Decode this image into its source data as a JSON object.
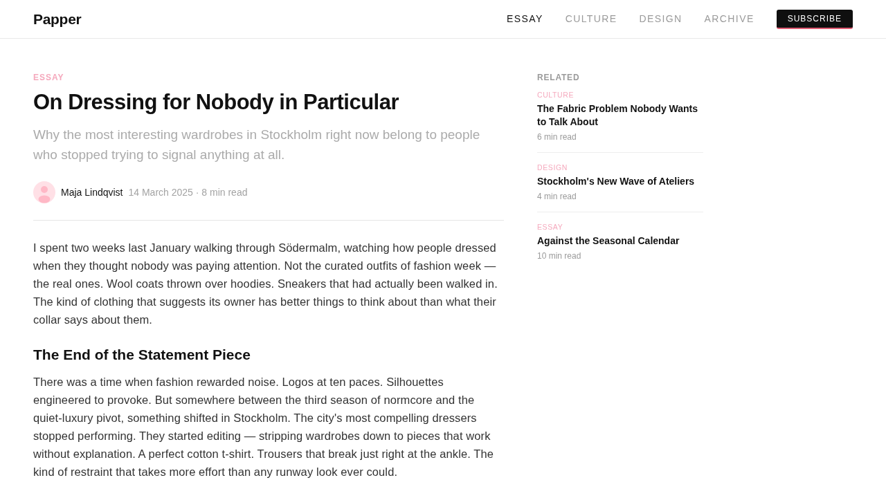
{
  "header": {
    "logo": "Papper",
    "nav": [
      {
        "label": "ESSAY",
        "selected": true
      },
      {
        "label": "CULTURE",
        "selected": false
      },
      {
        "label": "DESIGN",
        "selected": false
      },
      {
        "label": "ARCHIVE",
        "selected": false
      }
    ],
    "subscribe_button": "SUBSCRIBE"
  },
  "article": {
    "category": "ESSAY",
    "title": "On Dressing for Nobody in Particular",
    "subtitle": "Why the most interesting wardrobes in Stockholm right now belong to people who stopped trying to signal anything at all.",
    "author": {
      "name": "Maja Lindqvist",
      "meta": "14 March 2025 · 8 min read"
    },
    "body": [
      {
        "kind": "paragraph",
        "text": "I spent two weeks last January walking through Södermalm, watching how people dressed when they thought nobody was paying attention. Not the curated outfits of fashion week — the real ones. Wool coats thrown over hoodies. Sneakers that had actually been walked in. The kind of clothing that suggests its owner has better things to think about than what their collar says about them."
      },
      {
        "kind": "heading",
        "text": "The End of the Statement Piece"
      },
      {
        "kind": "paragraph",
        "text": "There was a time when fashion rewarded noise. Logos at ten paces. Silhouettes engineered to provoke. But somewhere between the third season of normcore and the quiet-luxury pivot, something shifted in Stockholm. The city's most compelling dressers stopped performing. They started editing — stripping wardrobes down to pieces that work without explanation. A perfect cotton t-shirt. Trousers that break just right at the ankle. The kind of restraint that takes more effort than any runway look ever could."
      }
    ]
  },
  "related": {
    "heading": "RELATED",
    "items": [
      {
        "category": "CULTURE",
        "title": "The Fabric Problem Nobody Wants to Talk About",
        "read_time": "6 min read"
      },
      {
        "category": "DESIGN",
        "title": "Stockholm's New Wave of Ateliers",
        "read_time": "4 min read"
      },
      {
        "category": "ESSAY",
        "title": "Against the Seasonal Calendar",
        "read_time": "10 min read"
      }
    ]
  }
}
